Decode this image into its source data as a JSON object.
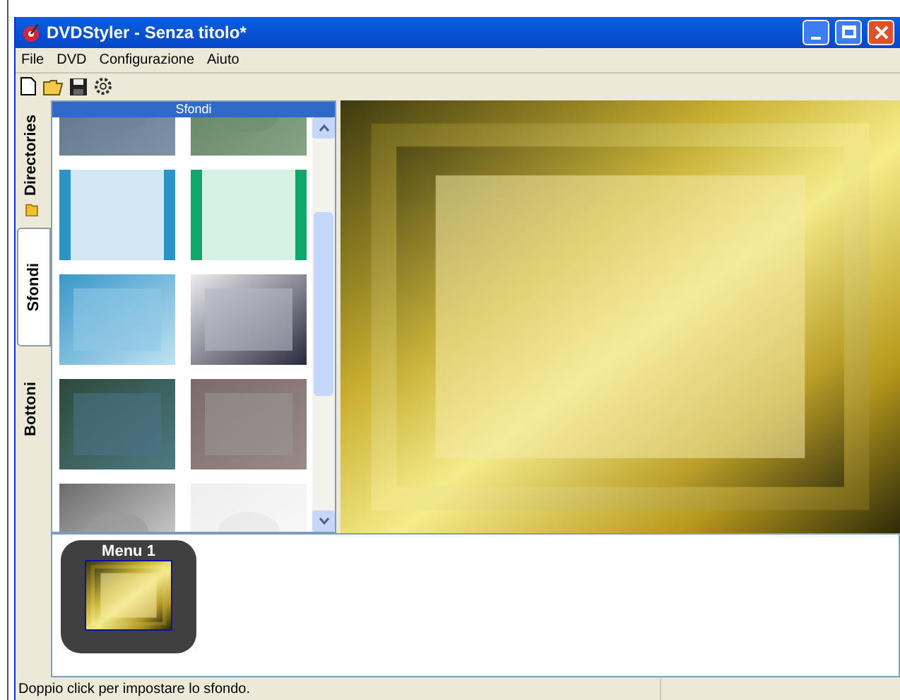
{
  "window": {
    "title": "DVDStyler - Senza titolo*"
  },
  "menu": [
    "File",
    "DVD",
    "Configurazione",
    "Aiuto"
  ],
  "side_tabs": [
    {
      "label": "Directories",
      "selected": false,
      "kind": "folder"
    },
    {
      "label": "Sfondi",
      "selected": true,
      "kind": "plain"
    },
    {
      "label": "Bottoni",
      "selected": false,
      "kind": "plain"
    }
  ],
  "panel": {
    "title": "Sfondi"
  },
  "menus": [
    {
      "label": "Menu 1",
      "kind": "picture"
    }
  ],
  "status_bar": "Doppio click per impostare lo sfondo."
}
